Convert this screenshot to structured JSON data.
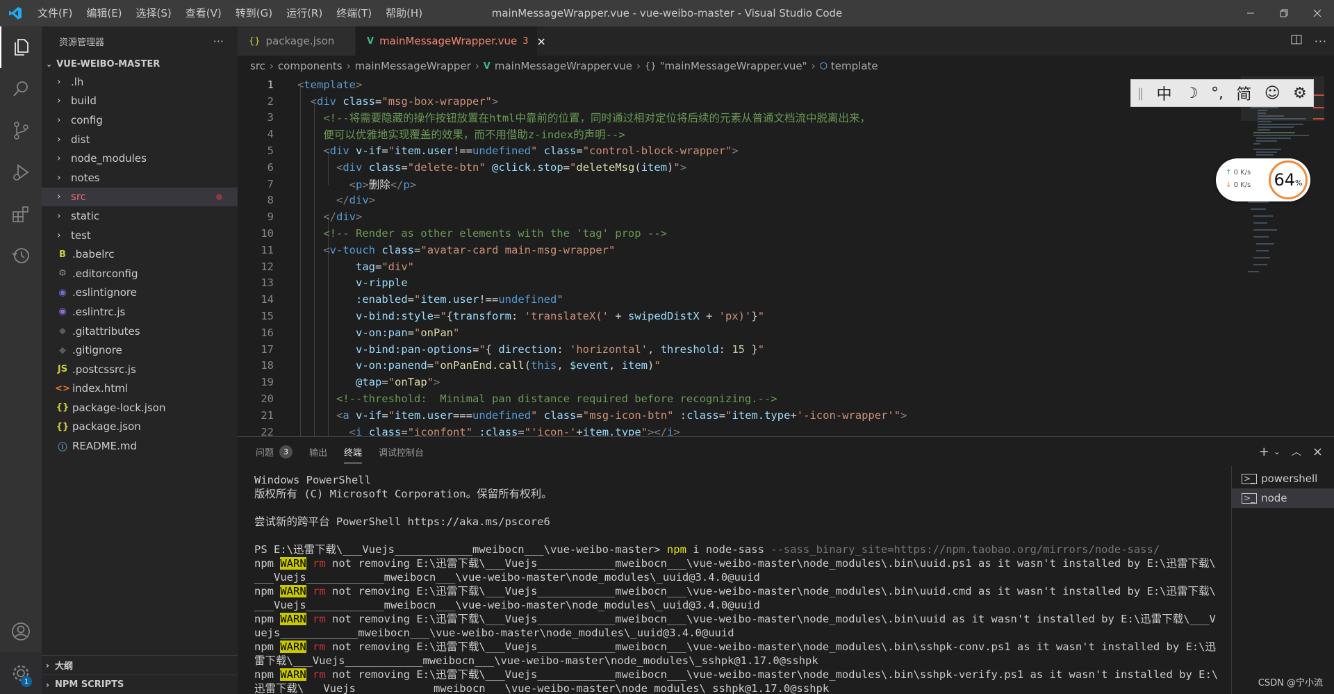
{
  "titlebar": {
    "menu": [
      "文件(F)",
      "编辑(E)",
      "选择(S)",
      "查看(V)",
      "转到(G)",
      "运行(R)",
      "终端(T)",
      "帮助(H)"
    ],
    "window_title": "mainMessageWrapper.vue - vue-weibo-master - Visual Studio Code"
  },
  "activity": {
    "items": [
      "explorer-icon",
      "search-icon",
      "source-control-icon",
      "run-debug-icon",
      "extensions-icon",
      "timeline-icon"
    ],
    "settings_badge": "1"
  },
  "sidebar": {
    "header": "资源管理器",
    "more": "···",
    "project": "VUE-WEIBO-MASTER",
    "folders": [
      ".lh",
      "build",
      "config",
      "dist",
      "node_modules",
      "notes",
      "src",
      "static",
      "test"
    ],
    "files": [
      {
        "name": ".babelrc",
        "icon": "B",
        "color": "#cbcb41"
      },
      {
        "name": ".editorconfig",
        "icon": "⚙",
        "color": "#8c8c8c"
      },
      {
        "name": ".eslintignore",
        "icon": "◉",
        "color": "#6d6dd6"
      },
      {
        "name": ".eslintrc.js",
        "icon": "◉",
        "color": "#8d6dd6"
      },
      {
        "name": ".gitattributes",
        "icon": "◆",
        "color": "#5a5a5a"
      },
      {
        "name": ".gitignore",
        "icon": "◆",
        "color": "#5a5a5a"
      },
      {
        "name": ".postcssrc.js",
        "icon": "JS",
        "color": "#cbcb41"
      },
      {
        "name": "index.html",
        "icon": "<>",
        "color": "#e37933"
      },
      {
        "name": "package-lock.json",
        "icon": "{}",
        "color": "#cbcb41"
      },
      {
        "name": "package.json",
        "icon": "{}",
        "color": "#cbcb41"
      },
      {
        "name": "README.md",
        "icon": "ⓘ",
        "color": "#519aba"
      }
    ],
    "outline": "大纲",
    "npm_scripts": "NPM SCRIPTS"
  },
  "tabs": [
    {
      "label": "package.json",
      "icon": "{}",
      "active": false
    },
    {
      "label": "mainMessageWrapper.vue",
      "icon": "V",
      "badge": "3",
      "active": true
    }
  ],
  "breadcrumb": [
    "src",
    "components",
    "mainMessageWrapper",
    "mainMessageWrapper.vue",
    "\"mainMessageWrapper.vue\"",
    "template"
  ],
  "editor": {
    "line_numbers": [
      "1",
      "2",
      "3",
      "4",
      "5",
      "6",
      "7",
      "8",
      "9",
      "10",
      "11",
      "12",
      "13",
      "14",
      "15",
      "16",
      "17",
      "18",
      "19",
      "20",
      "21",
      "22"
    ]
  },
  "ime": [
    "中",
    "☽",
    "°,",
    "简",
    "☺",
    "⚙"
  ],
  "net_widget": {
    "up": "0  K/s",
    "down": "0  K/s",
    "percent": "64",
    "unit": "%"
  },
  "panel": {
    "tabs": [
      "问题",
      "输出",
      "终端",
      "调试控制台"
    ],
    "problems_count": "3",
    "terminals": [
      "powershell",
      "node"
    ],
    "terminal_lines": [
      "Windows PowerShell",
      "版权所有 (C) Microsoft Corporation。保留所有权利。",
      "",
      "尝试新的跨平台 PowerShell https://aka.ms/pscore6",
      "",
      "PS E:\\迅雷下载\\___Vuejs____________mweibocn___\\vue-weibo-master> "
    ],
    "command": {
      "npm": "npm",
      "args": " i node-sass ",
      "flag": "--sass_binary_site=https://npm.taobao.org/mirrors/node-sass/"
    },
    "warn_lines": [
      {
        "rest": " not removing E:\\迅雷下载\\___Vuejs____________mweibocn___\\vue-weibo-master\\node_modules\\.bin\\uuid.ps1 as it wasn't installed by E:\\迅雷下载\\",
        "cont": "___Vuejs____________mweibocn___\\vue-weibo-master\\node_modules\\_uuid@3.4.0@uuid"
      },
      {
        "rest": " not removing E:\\迅雷下载\\___Vuejs____________mweibocn___\\vue-weibo-master\\node_modules\\.bin\\uuid.cmd as it wasn't installed by E:\\迅雷下载\\",
        "cont": "___Vuejs____________mweibocn___\\vue-weibo-master\\node_modules\\_uuid@3.4.0@uuid"
      },
      {
        "rest": " not removing E:\\迅雷下载\\___Vuejs____________mweibocn___\\vue-weibo-master\\node_modules\\.bin\\uuid as it wasn't installed by E:\\迅雷下载\\___V",
        "cont": "uejs____________mweibocn___\\vue-weibo-master\\node_modules\\_uuid@3.4.0@uuid"
      },
      {
        "rest": " not removing E:\\迅雷下载\\___Vuejs____________mweibocn___\\vue-weibo-master\\node_modules\\.bin\\sshpk-conv.ps1 as it wasn't installed by E:\\迅",
        "cont": "雷下载\\___Vuejs____________mweibocn___\\vue-weibo-master\\node_modules\\_sshpk@1.17.0@sshpk"
      },
      {
        "rest": " not removing E:\\迅雷下载\\___Vuejs____________mweibocn___\\vue-weibo-master\\node_modules\\.bin\\sshpk-verify.ps1 as it wasn't installed by E:\\",
        "cont": "迅雷下载\\___Vuejs____________mweibocn___\\vue-weibo-master\\node_modules\\_sshpk@1.17.0@sshpk"
      }
    ],
    "warn_prefix": "npm",
    "warn_tag": "WARN",
    "warn_rm": "rm"
  },
  "watermark": "CSDN @宁小流"
}
